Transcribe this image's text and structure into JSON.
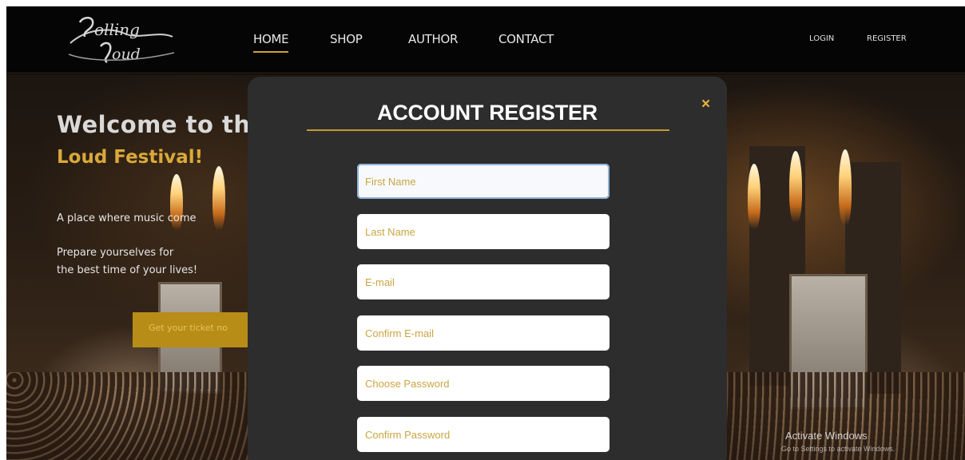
{
  "nav": {
    "logo_text": "Rolling Loud",
    "links": [
      "HOME",
      "SHOP",
      "AUTHOR",
      "CONTACT"
    ],
    "login": "LOGIN",
    "register": "REGISTER"
  },
  "hero": {
    "title_line1": "Welcome to th",
    "title_line2": "Loud Festival!",
    "tagline": "A place where music come",
    "prepare_line1": "Prepare yourselves for",
    "prepare_line2": "the best time of your lives!",
    "cta": "Get your ticket no"
  },
  "modal": {
    "title": "ACCOUNT REGISTER",
    "close": "×",
    "fields": {
      "first_name": "First Name",
      "last_name": "Last Name",
      "email": "E-mail",
      "confirm_email": "Confirm E-mail",
      "password": "Choose Password",
      "confirm_password": "Confirm Password"
    }
  },
  "os_watermark": {
    "line1": "Activate Windows",
    "line2": "Go to Settings to activate Windows."
  },
  "colors": {
    "accent_gold": "#cfa23a",
    "modal_bg": "#2d2d2d",
    "nav_bg": "#050505",
    "placeholder": "#caa542"
  }
}
